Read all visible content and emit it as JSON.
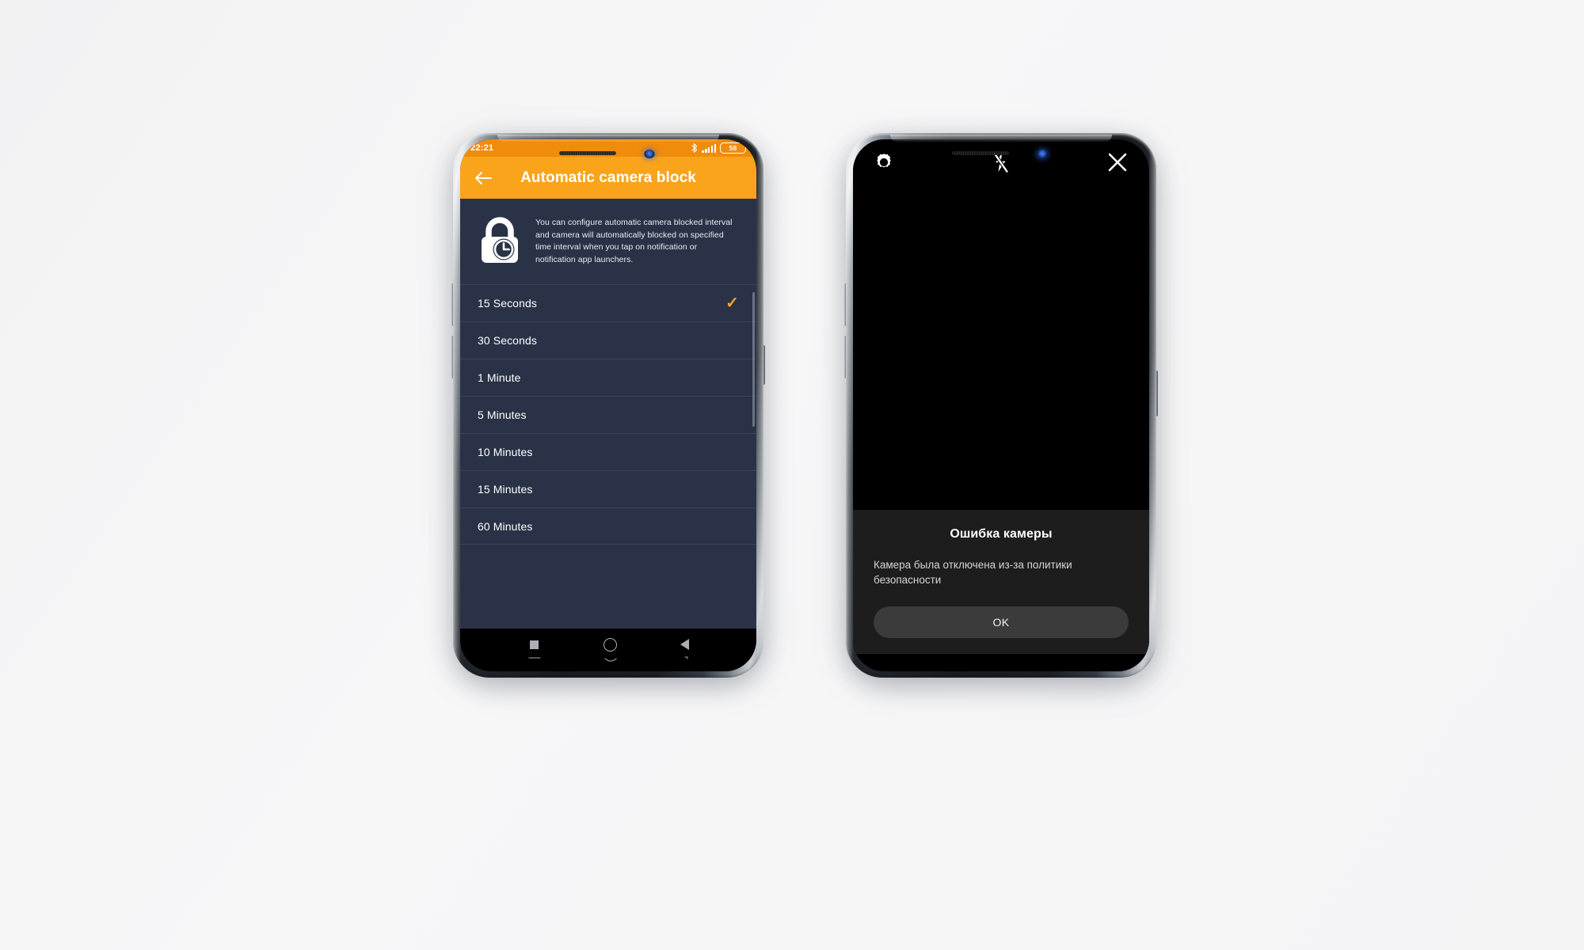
{
  "scene": {
    "background_color": "#f4f4f5",
    "device_count": 2
  },
  "left_phone": {
    "device_name": "android-phone-settings",
    "status_bar": {
      "time": "22:21",
      "bluetooth_icon": "bluetooth-icon",
      "signal_icon": "signal-bars-icon",
      "battery_level": "58",
      "background_color": "#f08c0c"
    },
    "app_bar": {
      "back_icon": "back-arrow-icon",
      "title": "Automatic camera block",
      "background_color": "#faa41b"
    },
    "info_card": {
      "icon": "lock-clock-icon",
      "text": "You can configure automatic camera blocked interval and camera will automatically blocked on specified time interval when you tap on notification or notification app launchers."
    },
    "options": [
      {
        "label": "15 Seconds",
        "selected": true,
        "check_glyph": "✓"
      },
      {
        "label": "30 Seconds",
        "selected": false,
        "check_glyph": ""
      },
      {
        "label": "1 Minute",
        "selected": false,
        "check_glyph": ""
      },
      {
        "label": "5 Minutes",
        "selected": false,
        "check_glyph": ""
      },
      {
        "label": "10 Minutes",
        "selected": false,
        "check_glyph": ""
      },
      {
        "label": "15 Minutes",
        "selected": false,
        "check_glyph": ""
      },
      {
        "label": "60 Minutes",
        "selected": false,
        "check_glyph": ""
      }
    ],
    "accent_color": "#f2a32a",
    "body_color": "#2a3247",
    "nav_bar": {
      "recents_icon": "recents-square-icon",
      "home_icon": "home-circle-icon",
      "back_icon": "back-triangle-icon"
    }
  },
  "right_phone": {
    "device_name": "android-phone-camera",
    "camera_toolbar": {
      "settings_icon": "camera-settings-gear-icon",
      "flash_icon": "flash-off-icon",
      "close_icon": "close-x-icon"
    },
    "error_dialog": {
      "title": "Ошибка камеры",
      "message": "Камера была отключена из-за политики безопасности",
      "ok_label": "OK",
      "sheet_color": "#1d1d1d",
      "button_color": "#3b3b3b"
    }
  }
}
